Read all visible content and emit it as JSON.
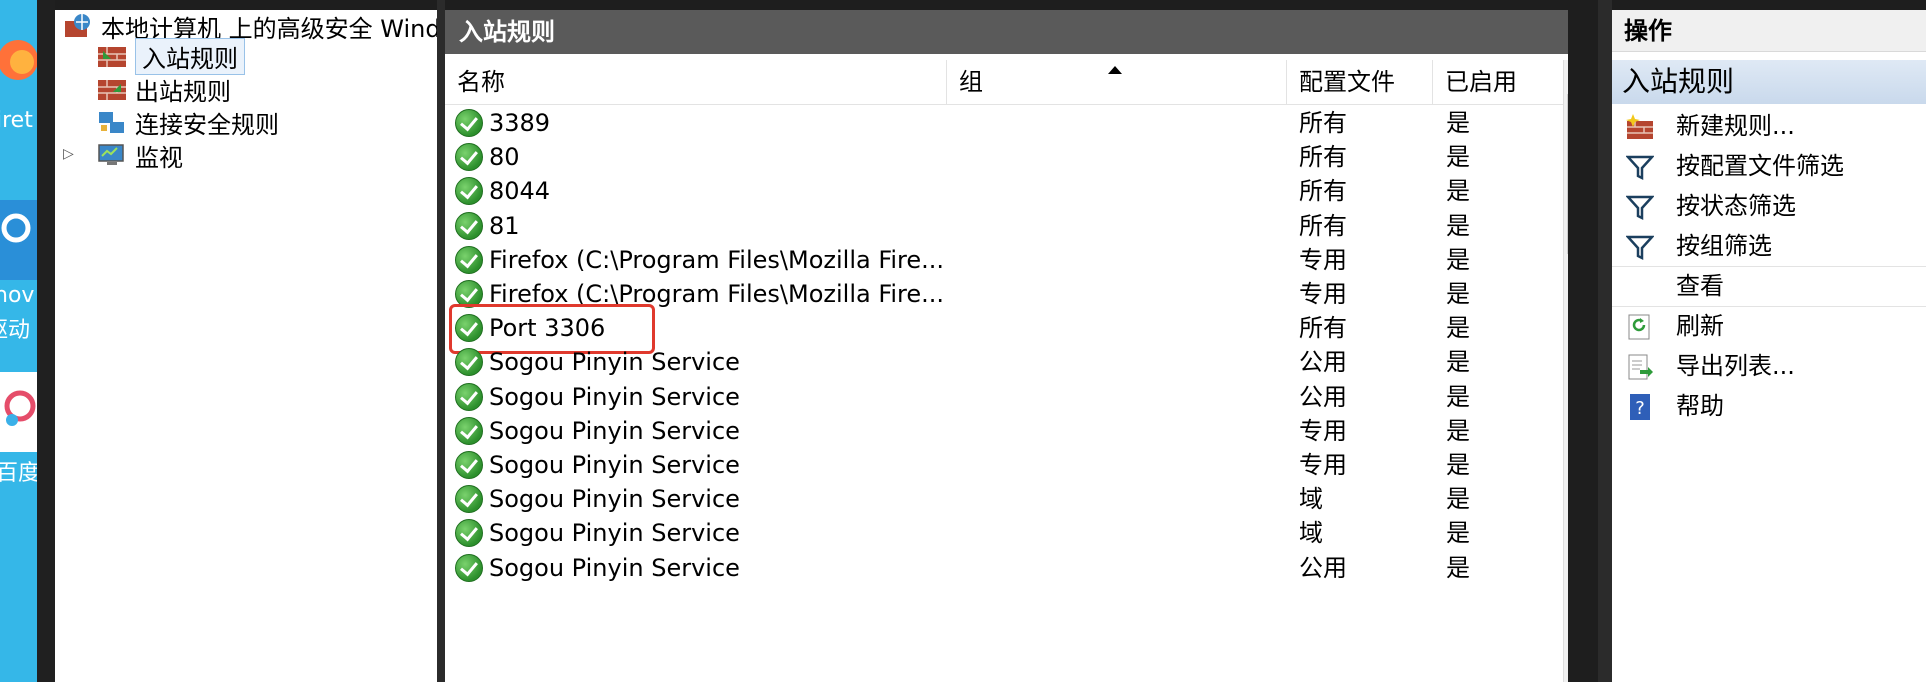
{
  "desktop": {
    "labels": [
      "iret",
      "nov",
      "驱动",
      "百度"
    ]
  },
  "tree": {
    "root": "本地计算机 上的高级安全 Windows Defender 防火墙",
    "items": [
      {
        "label": "入站规则",
        "selected": true
      },
      {
        "label": "出站规则"
      },
      {
        "label": "连接安全规则"
      },
      {
        "label": "监视"
      }
    ]
  },
  "center": {
    "title": "入站规则",
    "columns": [
      "名称",
      "组",
      "配置文件",
      "已启用"
    ],
    "rows": [
      {
        "name": "3389",
        "group": "",
        "profile": "所有",
        "enabled": "是"
      },
      {
        "name": "80",
        "group": "",
        "profile": "所有",
        "enabled": "是"
      },
      {
        "name": "8044",
        "group": "",
        "profile": "所有",
        "enabled": "是"
      },
      {
        "name": "81",
        "group": "",
        "profile": "所有",
        "enabled": "是"
      },
      {
        "name": "Firefox (C:\\Program Files\\Mozilla Fire...",
        "group": "",
        "profile": "专用",
        "enabled": "是"
      },
      {
        "name": "Firefox (C:\\Program Files\\Mozilla Fire...",
        "group": "",
        "profile": "专用",
        "enabled": "是"
      },
      {
        "name": "Port 3306",
        "group": "",
        "profile": "所有",
        "enabled": "是",
        "highlighted": true
      },
      {
        "name": "Sogou Pinyin Service",
        "group": "",
        "profile": "公用",
        "enabled": "是"
      },
      {
        "name": "Sogou Pinyin Service",
        "group": "",
        "profile": "公用",
        "enabled": "是"
      },
      {
        "name": "Sogou Pinyin Service",
        "group": "",
        "profile": "专用",
        "enabled": "是"
      },
      {
        "name": "Sogou Pinyin Service",
        "group": "",
        "profile": "专用",
        "enabled": "是"
      },
      {
        "name": "Sogou Pinyin Service",
        "group": "",
        "profile": "域",
        "enabled": "是"
      },
      {
        "name": "Sogou Pinyin Service",
        "group": "",
        "profile": "域",
        "enabled": "是"
      },
      {
        "name": "Sogou Pinyin Service",
        "group": "",
        "profile": "公用",
        "enabled": "是"
      }
    ]
  },
  "actions": {
    "title": "操作",
    "section": "入站规则",
    "items": [
      {
        "label": "新建规则...",
        "icon": "new-rule-icon"
      },
      {
        "label": "按配置文件筛选",
        "icon": "filter-icon"
      },
      {
        "label": "按状态筛选",
        "icon": "filter-icon"
      },
      {
        "label": "按组筛选",
        "icon": "filter-icon"
      },
      {
        "label": "查看",
        "icon": ""
      },
      {
        "label": "刷新",
        "icon": "refresh-icon"
      },
      {
        "label": "导出列表...",
        "icon": "export-icon"
      },
      {
        "label": "帮助",
        "icon": "help-icon"
      }
    ]
  },
  "colors": {
    "center_title_bg": "#5a5a5a",
    "highlight": "#e0392d",
    "check_green": "#2c8f2c",
    "desktop_blue": "#35b7e8"
  }
}
